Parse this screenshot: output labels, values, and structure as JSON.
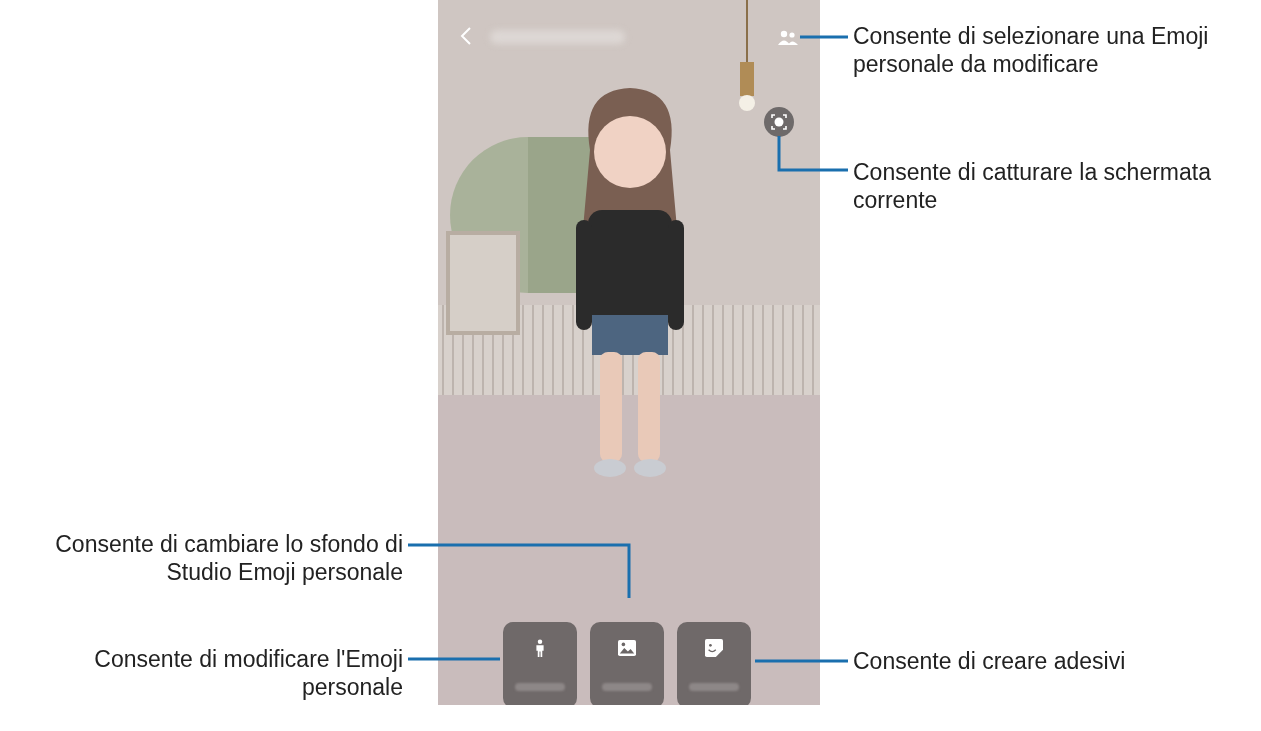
{
  "screen": {
    "buttons": [
      {
        "kind": "body"
      },
      {
        "kind": "background"
      },
      {
        "kind": "sticker"
      }
    ]
  },
  "callouts": [
    {
      "text": "Consente di selezionare una Emoji personale da modificare"
    },
    {
      "text": "Consente di catturare la schermata corrente"
    },
    {
      "text": "Consente di cambiare lo sfondo di Studio Emoji personale"
    },
    {
      "text": "Consente di modificare l'Emoji personale"
    },
    {
      "text": "Consente di creare adesivi"
    }
  ]
}
